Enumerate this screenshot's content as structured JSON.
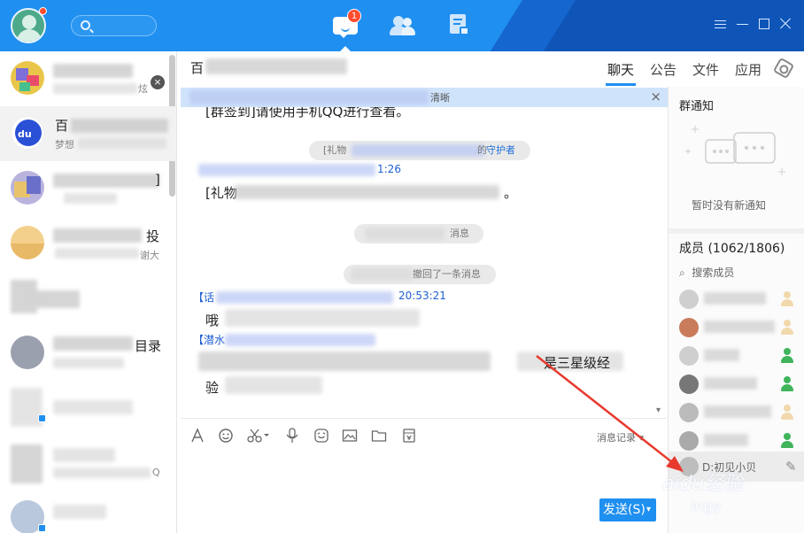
{
  "topbar": {
    "message_badge_count": "1"
  },
  "conversations": [
    {
      "name": "",
      "sub": "",
      "right": "",
      "right_sub": "炫"
    },
    {
      "name": "百",
      "sub": "梦想",
      "right": "",
      "right_sub": ""
    },
    {
      "name": "",
      "sub": "",
      "right": "]",
      "right_sub": ""
    },
    {
      "name": "",
      "sub": "",
      "right": "投",
      "right_sub": "谢大"
    },
    {
      "name": "",
      "sub": "",
      "right": "",
      "right_sub": ""
    },
    {
      "name": "",
      "sub": "",
      "right": "目录",
      "right_sub": ""
    },
    {
      "name": "",
      "sub": "",
      "right": "",
      "right_sub": ""
    },
    {
      "name": "",
      "sub": "",
      "right": "",
      "right_sub": "Q"
    },
    {
      "name": "",
      "sub": "",
      "right": "",
      "right_sub": ""
    }
  ],
  "chat": {
    "title": "百",
    "notice_text": "清晰",
    "messages": {
      "line1": "[群签到]请使用手机QQ进行查看。",
      "sys1_prefix": "[礼物",
      "sys1_suffix": "的",
      "sys1_link": "守护者",
      "sender1_time": "1:26",
      "line2_start": "[礼物",
      "line2_end": "。",
      "sys2": "消息",
      "sys3": "撤回了一条消息",
      "sender2_prefix": "【话",
      "sender2_time": "20:53:21",
      "line3": "哦",
      "sender3_prefix": "【潜水",
      "line4_end": "是三星级经",
      "line5": "验"
    },
    "history_label": "消息记录",
    "send_label": "发送(S)"
  },
  "tabs": {
    "chat": "聊天",
    "notice": "公告",
    "file": "文件",
    "app": "应用"
  },
  "right_panel": {
    "notice_title": "群通知",
    "empty_notice": "暂时没有新通知",
    "members_label": "成员 (1062/1806)",
    "search_placeholder": "搜索成员",
    "last_member": "D:初见小贝"
  },
  "watermark": {
    "brand": "aidu经验",
    "sub": "ingy"
  },
  "colors": {
    "accent": "#1f8ff0",
    "link": "#1f6fd6",
    "badge": "#ff4d2e",
    "annotation": "#e83a2e"
  }
}
